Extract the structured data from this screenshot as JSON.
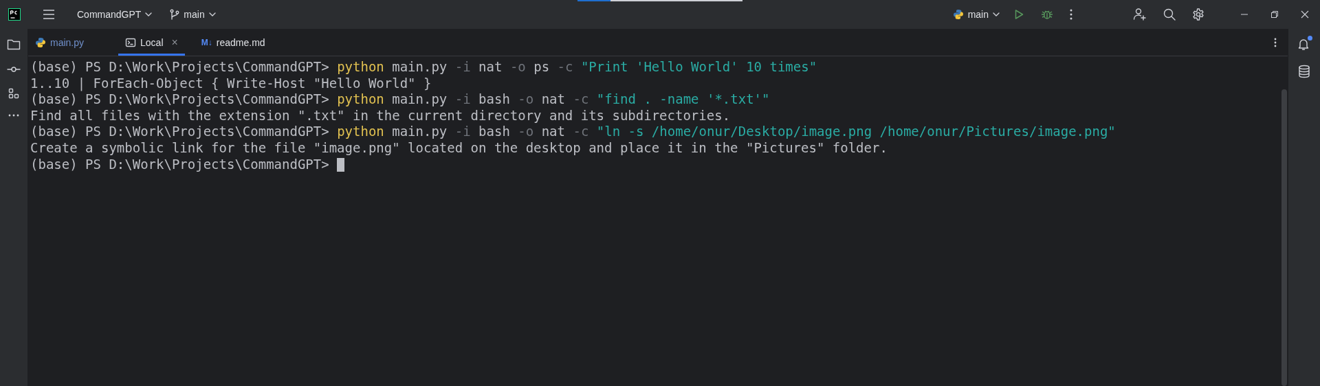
{
  "title_bar": {
    "project": "CommandGPT",
    "branch": "main",
    "run_config": "main",
    "progress": {
      "level": 0.2
    }
  },
  "tabs": [
    {
      "label": "main.py",
      "kind": "python",
      "selected": false,
      "closable": false,
      "color": "#6f8fc9"
    },
    {
      "label": "Local",
      "kind": "terminal",
      "selected": true,
      "closable": true,
      "close_glyph": "×",
      "color": "#dfe1e5"
    },
    {
      "label": "readme.md",
      "kind": "markdown",
      "icon_text": "M↓",
      "selected": false,
      "closable": false,
      "color": "#dfe1e5"
    }
  ],
  "terminal": {
    "lines": [
      {
        "segments": [
          {
            "kind": "prompt",
            "text": "(base) PS D:\\Work\\Projects\\CommandGPT>"
          },
          {
            "kind": "command",
            "text": "python"
          },
          {
            "kind": "arg",
            "text": "main.py"
          },
          {
            "kind": "flag",
            "text": "-i"
          },
          {
            "kind": "arg",
            "text": "nat"
          },
          {
            "kind": "flag",
            "text": "-o"
          },
          {
            "kind": "arg",
            "text": "ps"
          },
          {
            "kind": "flag",
            "text": "-c"
          },
          {
            "kind": "string",
            "text": "\"Print 'Hello World' 10 times\""
          }
        ]
      },
      {
        "segments": [
          {
            "kind": "output",
            "text": "1..10 | ForEach-Object { Write-Host \"Hello World\" }"
          }
        ]
      },
      {
        "segments": [
          {
            "kind": "prompt",
            "text": "(base) PS D:\\Work\\Projects\\CommandGPT>"
          },
          {
            "kind": "command",
            "text": "python"
          },
          {
            "kind": "arg",
            "text": "main.py"
          },
          {
            "kind": "flag",
            "text": "-i"
          },
          {
            "kind": "arg",
            "text": "bash"
          },
          {
            "kind": "flag",
            "text": "-o"
          },
          {
            "kind": "arg",
            "text": "nat"
          },
          {
            "kind": "flag",
            "text": "-c"
          },
          {
            "kind": "string",
            "text": "\"find . -name '*.txt'\""
          }
        ]
      },
      {
        "segments": [
          {
            "kind": "output",
            "text": "Find all files with the extension \".txt\" in the current directory and its subdirectories."
          }
        ]
      },
      {
        "segments": [
          {
            "kind": "prompt",
            "text": "(base) PS D:\\Work\\Projects\\CommandGPT>"
          },
          {
            "kind": "command",
            "text": "python"
          },
          {
            "kind": "arg",
            "text": "main.py"
          },
          {
            "kind": "flag",
            "text": "-i"
          },
          {
            "kind": "arg",
            "text": "bash"
          },
          {
            "kind": "flag",
            "text": "-o"
          },
          {
            "kind": "arg",
            "text": "nat"
          },
          {
            "kind": "flag",
            "text": "-c"
          },
          {
            "kind": "string",
            "text": "\"ln -s /home/onur/Desktop/image.png /home/onur/Pictures/image.png\""
          }
        ]
      },
      {
        "segments": [
          {
            "kind": "output",
            "text": "Create a symbolic link for the file \"image.png\" located on the desktop and place it in the \"Pictures\" folder."
          }
        ]
      },
      {
        "segments": [
          {
            "kind": "prompt",
            "text": "(base) PS D:\\Work\\Projects\\CommandGPT>"
          }
        ],
        "cursor": true
      }
    ]
  },
  "notifications": {
    "unread": true
  }
}
